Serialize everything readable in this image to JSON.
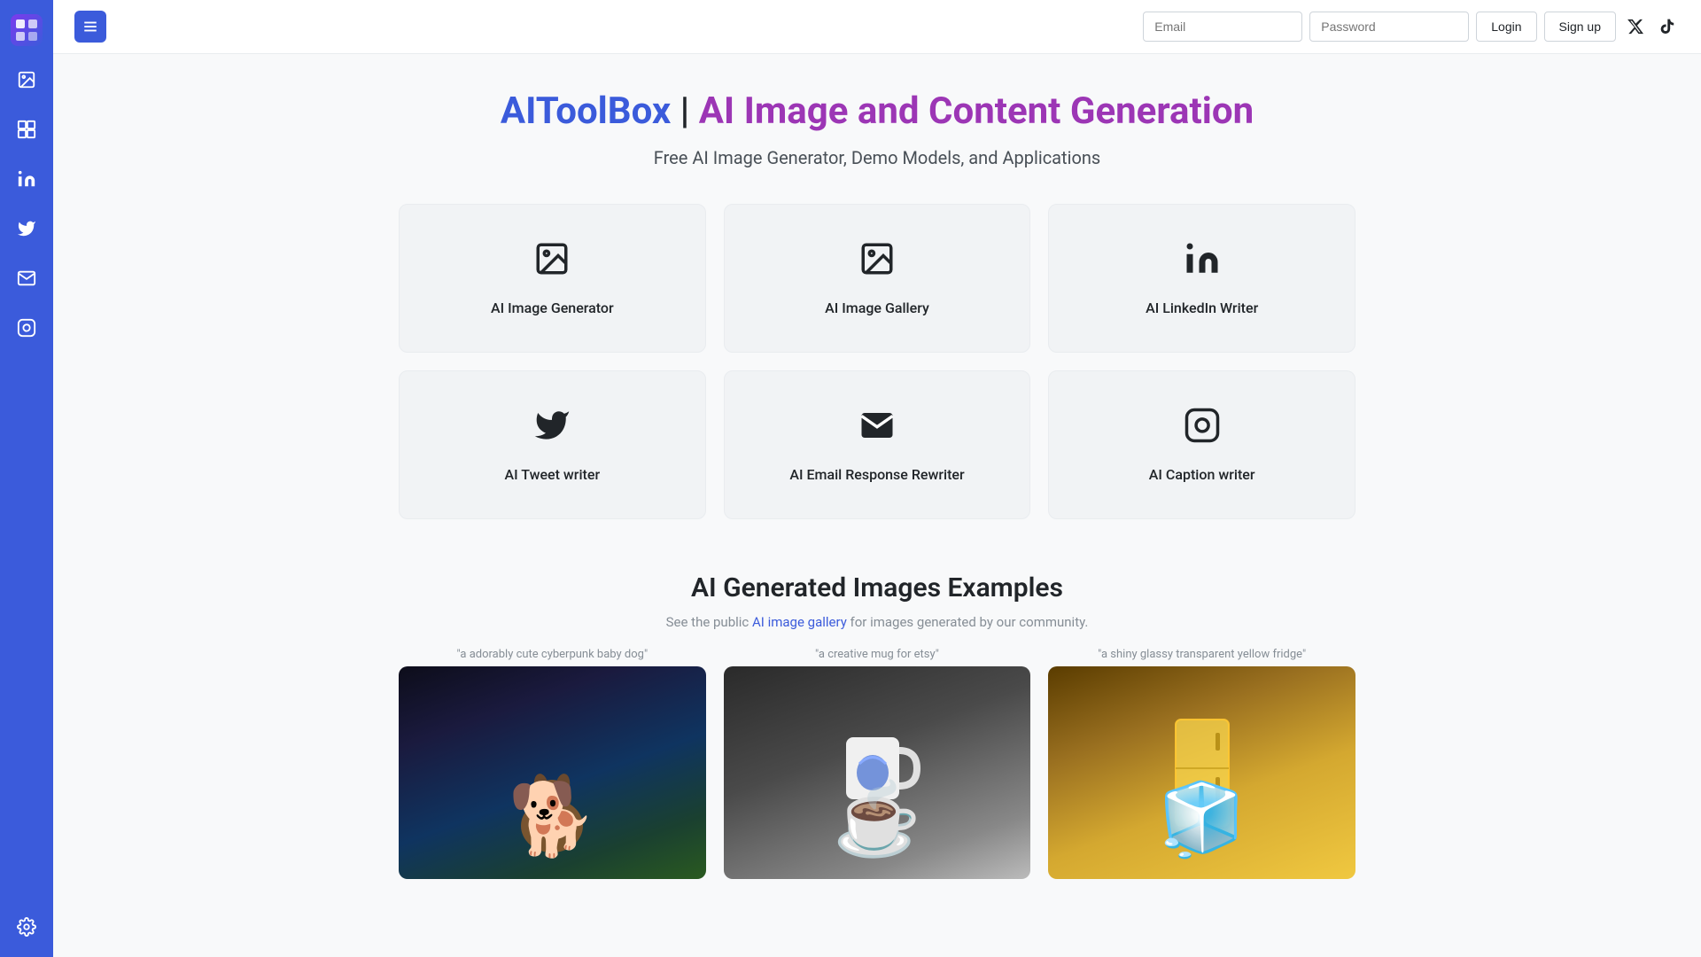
{
  "sidebar": {
    "logo_icon": "🎨",
    "icons": [
      {
        "name": "image-generator-icon",
        "symbol": "🖼",
        "label": "AI Image Generator"
      },
      {
        "name": "image-gallery-icon",
        "symbol": "🗃",
        "label": "AI Image Gallery"
      },
      {
        "name": "linkedin-icon",
        "symbol": "in",
        "label": "AI LinkedIn Writer"
      },
      {
        "name": "twitter-icon",
        "symbol": "🐦",
        "label": "AI Tweet Writer"
      },
      {
        "name": "email-icon",
        "symbol": "✉",
        "label": "AI Email Response"
      },
      {
        "name": "instagram-icon",
        "symbol": "📷",
        "label": "AI Caption Writer"
      },
      {
        "name": "settings-icon",
        "symbol": "⚙",
        "label": "Settings"
      }
    ]
  },
  "header": {
    "menu_label": "☰",
    "email_placeholder": "Email",
    "password_placeholder": "Password",
    "login_label": "Login",
    "signup_label": "Sign up"
  },
  "page": {
    "title_blue": "AIToolBox",
    "title_sep": " | ",
    "title_purple": "AI Image and Content Generation",
    "subtitle": "Free AI Image Generator, Demo Models, and Applications"
  },
  "tools": [
    {
      "id": "ai-image-generator",
      "label": "AI Image Generator",
      "icon": "image-gen"
    },
    {
      "id": "ai-image-gallery",
      "label": "AI Image Gallery",
      "icon": "image-gallery"
    },
    {
      "id": "ai-linkedin-writer",
      "label": "AI LinkedIn Writer",
      "icon": "linkedin"
    },
    {
      "id": "ai-tweet-writer",
      "label": "AI Tweet writer",
      "icon": "twitter"
    },
    {
      "id": "ai-email-response-rewriter",
      "label": "AI Email Response Rewriter",
      "icon": "email"
    },
    {
      "id": "ai-caption-writer",
      "label": "AI Caption writer",
      "icon": "instagram"
    }
  ],
  "examples": {
    "title": "AI Generated Images Examples",
    "desc_prefix": "See the public ",
    "gallery_link_text": "AI image gallery",
    "desc_suffix": " for images generated by our community.",
    "images": [
      {
        "caption": "\"a adorably cute cyberpunk baby dog\"",
        "type": "dog"
      },
      {
        "caption": "\"a creative mug for etsy\"",
        "type": "mug"
      },
      {
        "caption": "\"a shiny glassy transparent yellow fridge\"",
        "type": "fridge"
      }
    ]
  }
}
